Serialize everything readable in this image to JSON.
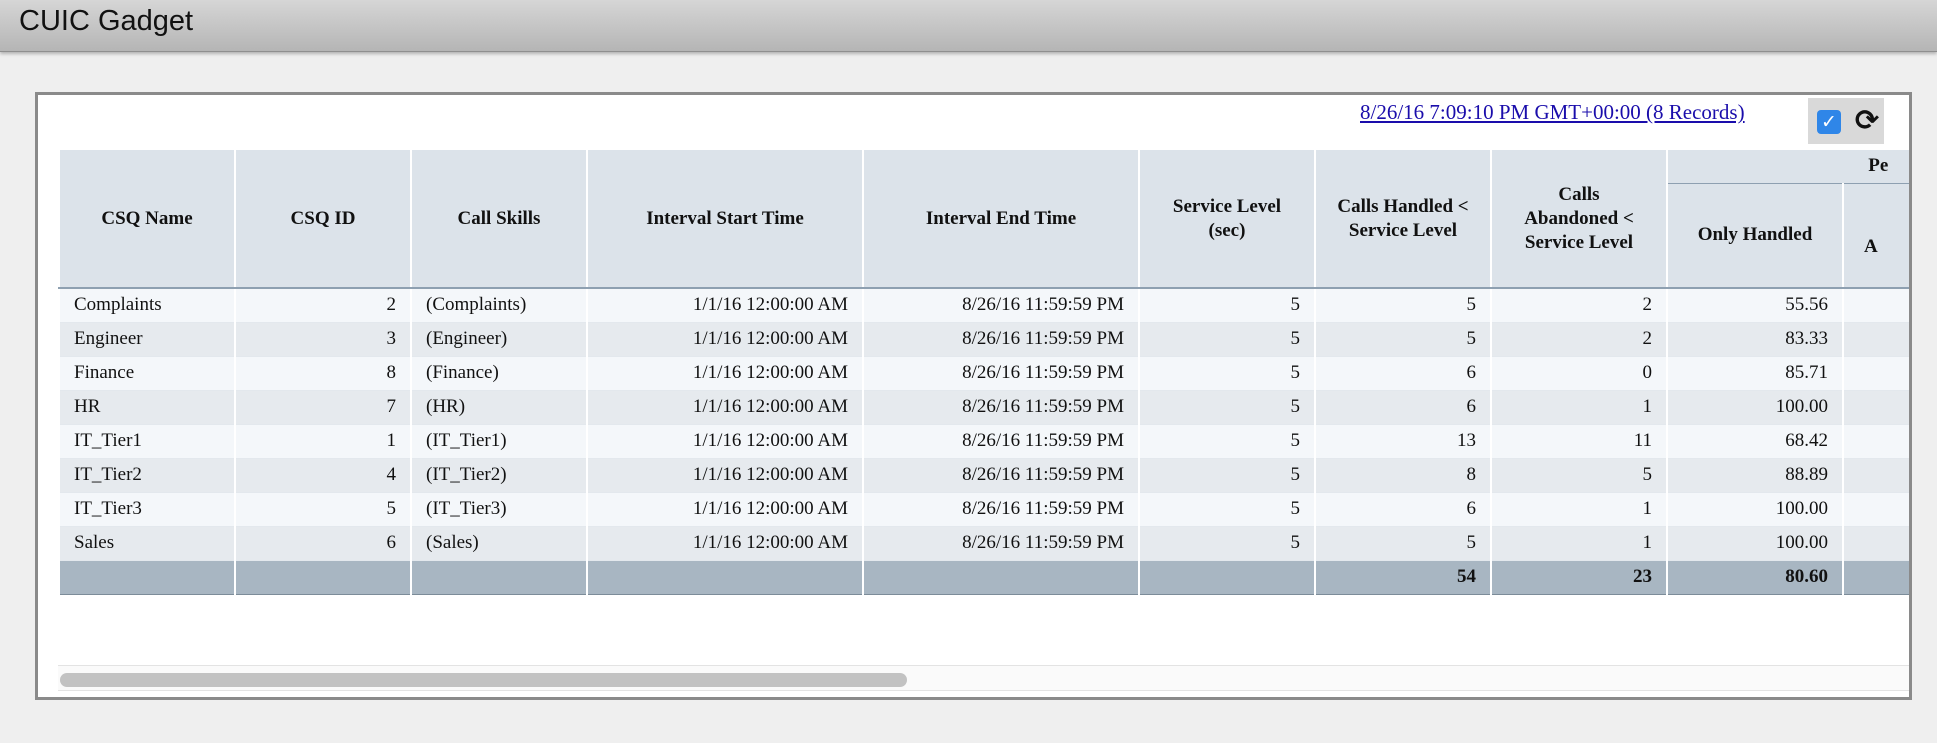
{
  "window": {
    "title": "CUIC Gadget"
  },
  "report": {
    "timestamp_link": "8/26/16 7:09:10 PM GMT+00:00 (8 Records)",
    "checkbox_glyph": "✓",
    "refresh_glyph": "⟳",
    "icons": [
      "checkbox-checked-icon",
      "refresh-icon"
    ]
  },
  "table": {
    "group_header": "Pe",
    "columns": {
      "csq_name": "CSQ Name",
      "csq_id": "CSQ ID",
      "call_skills": "Call Skills",
      "interval_start": "Interval Start Time",
      "interval_end": "Interval End Time",
      "service_level_1": "Service Level",
      "service_level_2": "(sec)",
      "calls_handled_1": "Calls Handled <",
      "calls_handled_2": "Service Level",
      "calls_abandoned_1": "Calls",
      "calls_abandoned_2": "Abandoned <",
      "calls_abandoned_3": "Service Level",
      "only_handled": "Only Handled",
      "cut_1": "",
      "cut_2": "A"
    },
    "rows": [
      {
        "name": "Complaints",
        "id": "2",
        "skills": "(Complaints)",
        "start": "1/1/16 12:00:00 AM",
        "end": "8/26/16 11:59:59 PM",
        "sl": "5",
        "handled": "5",
        "abandoned": "2",
        "only_handled": "55.56"
      },
      {
        "name": "Engineer",
        "id": "3",
        "skills": "(Engineer)",
        "start": "1/1/16 12:00:00 AM",
        "end": "8/26/16 11:59:59 PM",
        "sl": "5",
        "handled": "5",
        "abandoned": "2",
        "only_handled": "83.33"
      },
      {
        "name": "Finance",
        "id": "8",
        "skills": "(Finance)",
        "start": "1/1/16 12:00:00 AM",
        "end": "8/26/16 11:59:59 PM",
        "sl": "5",
        "handled": "6",
        "abandoned": "0",
        "only_handled": "85.71"
      },
      {
        "name": "HR",
        "id": "7",
        "skills": "(HR)",
        "start": "1/1/16 12:00:00 AM",
        "end": "8/26/16 11:59:59 PM",
        "sl": "5",
        "handled": "6",
        "abandoned": "1",
        "only_handled": "100.00"
      },
      {
        "name": "IT_Tier1",
        "id": "1",
        "skills": "(IT_Tier1)",
        "start": "1/1/16 12:00:00 AM",
        "end": "8/26/16 11:59:59 PM",
        "sl": "5",
        "handled": "13",
        "abandoned": "11",
        "only_handled": "68.42"
      },
      {
        "name": "IT_Tier2",
        "id": "4",
        "skills": "(IT_Tier2)",
        "start": "1/1/16 12:00:00 AM",
        "end": "8/26/16 11:59:59 PM",
        "sl": "5",
        "handled": "8",
        "abandoned": "5",
        "only_handled": "88.89"
      },
      {
        "name": "IT_Tier3",
        "id": "5",
        "skills": "(IT_Tier3)",
        "start": "1/1/16 12:00:00 AM",
        "end": "8/26/16 11:59:59 PM",
        "sl": "5",
        "handled": "6",
        "abandoned": "1",
        "only_handled": "100.00"
      },
      {
        "name": "Sales",
        "id": "6",
        "skills": "(Sales)",
        "start": "1/1/16 12:00:00 AM",
        "end": "8/26/16 11:59:59 PM",
        "sl": "5",
        "handled": "5",
        "abandoned": "1",
        "only_handled": "100.00"
      }
    ],
    "totals": {
      "handled": "54",
      "abandoned": "23",
      "only_handled": "80.60"
    }
  }
}
